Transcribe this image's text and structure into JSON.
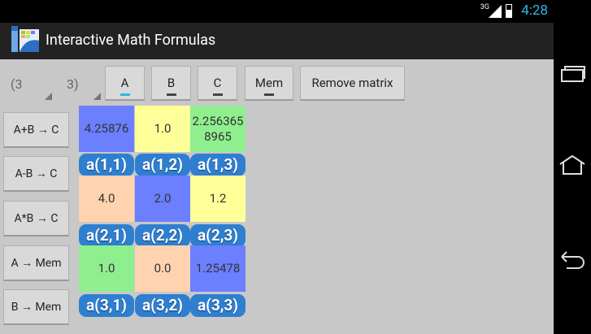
{
  "status_bar": {
    "network": "3G",
    "time": "4:28"
  },
  "app": {
    "title": "Interactive Math Formulas"
  },
  "toolbar": {
    "rows_value": "(3",
    "cols_value": "3)",
    "tabs": [
      {
        "label": "A",
        "active": true
      },
      {
        "label": "B",
        "active": false
      },
      {
        "label": "C",
        "active": false
      },
      {
        "label": "Mem",
        "active": false
      }
    ],
    "remove_label": "Remove matrix"
  },
  "sidebar": {
    "buttons": [
      {
        "label": "A+B → C"
      },
      {
        "label": "A-B → C"
      },
      {
        "label": "A*B → C"
      },
      {
        "label": "A → Mem"
      },
      {
        "label": "B → Mem"
      }
    ]
  },
  "matrix": {
    "cells": [
      [
        {
          "value": "4.25876",
          "label": "a(1,1)",
          "color": "#6b7fff"
        },
        {
          "value": "1.0",
          "label": "a(1,2)",
          "color": "#ffff99"
        },
        {
          "value": "2.256365\n8965",
          "label": "a(1,3)",
          "color": "#8fef8f"
        }
      ],
      [
        {
          "value": "4.0",
          "label": "a(2,1)",
          "color": "#ffd3b0"
        },
        {
          "value": "2.0",
          "label": "a(2,2)",
          "color": "#6b7fff"
        },
        {
          "value": "1.2",
          "label": "a(2,3)",
          "color": "#ffff99"
        }
      ],
      [
        {
          "value": "1.0",
          "label": "a(3,1)",
          "color": "#8fef8f"
        },
        {
          "value": "0.0",
          "label": "a(3,2)",
          "color": "#ffd3b0"
        },
        {
          "value": "1.25478",
          "label": "a(3,3)",
          "color": "#6b7fff"
        }
      ]
    ]
  }
}
